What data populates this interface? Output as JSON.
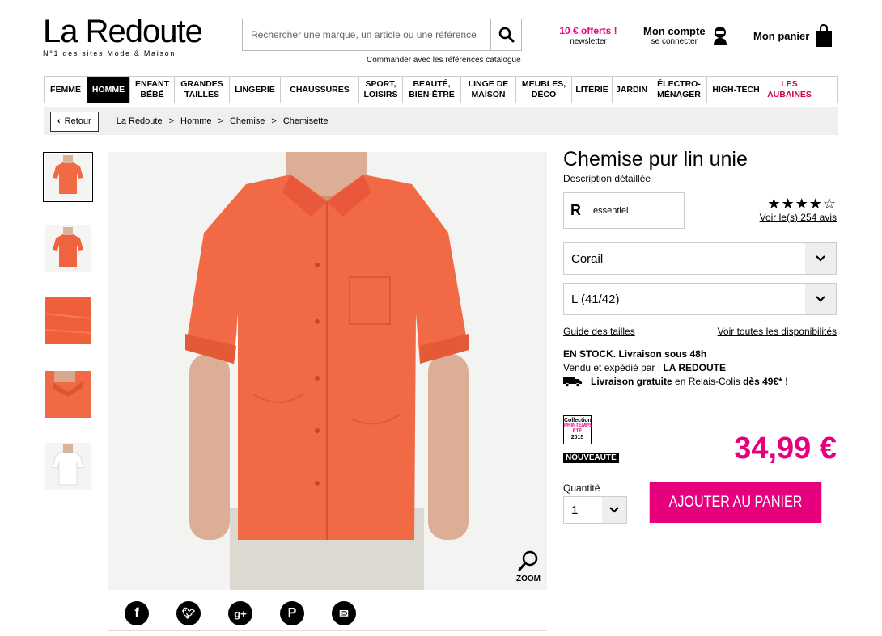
{
  "header": {
    "logo_name": "La Redoute",
    "logo_tagline": "N°1 des sites Mode & Maison",
    "search_placeholder": "Rechercher une marque, un article ou une référence",
    "catalogue_link": "Commander avec les références catalogue",
    "offer_title": "10 € offerts !",
    "offer_sub": "newsletter",
    "account_title": "Mon compte",
    "account_sub": "se connecter",
    "cart_label": "Mon panier"
  },
  "nav": {
    "items": [
      {
        "label": "FEMME"
      },
      {
        "label": "HOMME"
      },
      {
        "label": "ENFANT BÉBÉ"
      },
      {
        "label": "GRANDES TAILLES"
      },
      {
        "label": "LINGERIE"
      },
      {
        "label": "CHAUSSURES"
      },
      {
        "label": "SPORT, LOISIRS"
      },
      {
        "label": "BEAUTÉ, BIEN-ÊTRE"
      },
      {
        "label": "LINGE DE MAISON"
      },
      {
        "label": "MEUBLES, DÉCO"
      },
      {
        "label": "LITERIE"
      },
      {
        "label": "JARDIN"
      },
      {
        "label": "ÉLECTRO-MÉNAGER"
      },
      {
        "label": "HIGH-TECH"
      },
      {
        "label": "LES AUBAINES"
      }
    ],
    "active": "HOMME",
    "promo": "LES AUBAINES"
  },
  "breadcrumb": {
    "back_label": "Retour",
    "items": [
      "La Redoute",
      "Homme",
      "Chemise",
      "Chemisette"
    ],
    "separator": ">"
  },
  "product": {
    "title": "Chemise pur lin unie",
    "desc_link": "Description détaillée",
    "brand_mark": "R",
    "brand_label": "essentiel.",
    "stars": "★★★★☆",
    "rating": 4,
    "reviews_link": "Voir le(s) 254 avis",
    "color_value": "Corail",
    "size_value": "L (41/42)",
    "size_guide": "Guide des tailles",
    "availability_link": "Voir toutes les disponibilités",
    "stock_text": "EN STOCK. Livraison sous 48h",
    "sold_prefix": "Vendu et expédié par :",
    "sold_by": "LA REDOUTE",
    "delivery_bold": "Livraison gratuite",
    "delivery_mid": "en Relais-Colis",
    "delivery_end": "dès 49€* !",
    "collection_1": "Collection",
    "collection_2": "PRINTEMPS",
    "collection_3": "ÉTÉ",
    "collection_4": "2015",
    "badge": "NOUVEAUTÉ",
    "price": "34,99 €",
    "qty_label": "Quantité",
    "qty_value": "1",
    "add_to_cart": "AJOUTER AU PANIER",
    "zoom_label": "ZOOM"
  },
  "colors": {
    "accent": "#e6007e",
    "promo": "#d6003c",
    "shirt": "#f26a45"
  }
}
